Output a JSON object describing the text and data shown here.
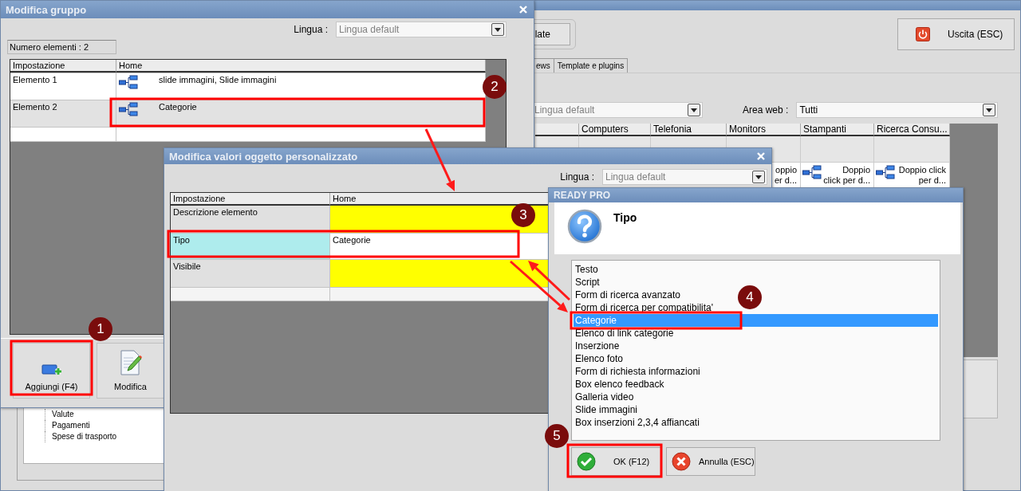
{
  "main_window": {
    "toolbar_buttons": [
      {
        "kind": "plain",
        "label": "late"
      },
      {
        "kind": "exit",
        "label": "Uscita (ESC)"
      }
    ],
    "tabs": [
      {
        "label": "ews",
        "selected": false
      },
      {
        "label": "Template e plugins",
        "selected": false
      }
    ],
    "language_value": "Lingua default",
    "area_web": {
      "label": "Area web :",
      "value": "Tutti"
    },
    "grid": {
      "columns": [
        "Computers",
        "Telefonia",
        "Monitors",
        "Stampanti",
        "Ricerca Consu..."
      ],
      "cells": [
        {
          "text": "oppio er d..."
        },
        {
          "text": "Doppio click per d..."
        },
        {
          "text": "Doppio click per d..."
        }
      ]
    },
    "tree_items": [
      "Valute",
      "Pagamenti",
      "Spese di trasporto"
    ]
  },
  "group_dialog": {
    "title": "Modifica gruppo",
    "language_label": "Lingua :",
    "language_value": "Lingua default",
    "count": "Numero elementi : 2",
    "columns": [
      "Impostazione",
      "Home"
    ],
    "rows": [
      {
        "label": "Elemento 1",
        "value": "slide immagini, Slide immagini",
        "selected": false
      },
      {
        "label": "Elemento 2",
        "value": "Categorie",
        "selected": true
      }
    ],
    "buttons": [
      {
        "kind": "add",
        "label": "Aggiungi (F4)"
      },
      {
        "kind": "edit",
        "label": "Modifica"
      }
    ]
  },
  "object_dialog": {
    "title": "Modifica valori oggetto personalizzato",
    "language_label": "Lingua :",
    "language_value": "Lingua default",
    "columns": [
      "Impostazione",
      "Home"
    ],
    "rows": [
      {
        "label": "Descrizione elemento",
        "required": true,
        "selected": false
      },
      {
        "label": "Tipo",
        "value": "Categorie",
        "required": false,
        "selected": true
      },
      {
        "label": "Visibile",
        "required": true,
        "selected": false
      }
    ]
  },
  "type_dialog": {
    "title": "READY PRO",
    "heading": "Tipo",
    "options": [
      {
        "label": "Testo",
        "selected": false
      },
      {
        "label": "Script",
        "selected": false
      },
      {
        "label": "Form di ricerca avanzato",
        "selected": false
      },
      {
        "label": "Form di ricerca per compatibilita'",
        "selected": false
      },
      {
        "label": "Categorie",
        "selected": true
      },
      {
        "label": "Elenco di link categorie",
        "selected": false
      },
      {
        "label": "Inserzione",
        "selected": false
      },
      {
        "label": "Elenco foto",
        "selected": false
      },
      {
        "label": "Form di richiesta informazioni",
        "selected": false
      },
      {
        "label": "Box elenco feedback",
        "selected": false
      },
      {
        "label": "Galleria video",
        "selected": false
      },
      {
        "label": "Slide immagini",
        "selected": false
      },
      {
        "label": "Box inserzioni 2,3,4 affiancati",
        "selected": false
      }
    ],
    "buttons": [
      {
        "kind": "ok",
        "label": "OK (F12)"
      },
      {
        "kind": "cancel",
        "label": "Annulla (ESC)"
      }
    ]
  },
  "annotations": {
    "badges": [
      "1",
      "2",
      "3",
      "4",
      "5"
    ]
  }
}
